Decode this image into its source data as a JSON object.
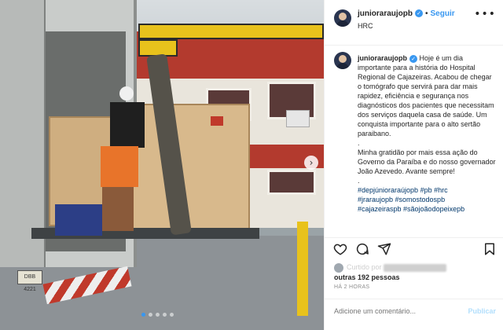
{
  "header": {
    "username": "junioraraujopb",
    "separator": "•",
    "follow_label": "Seguir",
    "location": "HRC"
  },
  "caption": {
    "username": "junioraraujopb",
    "paragraph1": "Hoje é um dia importante para a história do Hospital Regional de Cajazeiras. Acabou de chegar o tomógrafo que servirá para dar mais rapidez, eficiência e segurança nos diagnósticos dos pacientes que necessitam dos serviços daquela casa de saúde. Um conquista importante para o alto sertão paraibano.",
    "dot1": ".",
    "paragraph2": "Minha gratidão por mais essa ação do Governo da Paraíba e do nosso governador João Azevedo. Avante sempre!",
    "dot2": ".",
    "hashtags": [
      "#depjúnioraraújopb #pb #hrc",
      "#jraraujopb #somostodospb",
      "#cajazeiraspb #sãojoãodopeixepb"
    ]
  },
  "likes": {
    "others_text": "outras 192 pessoas",
    "curtido_prefix": "Curtido por"
  },
  "time": "HÁ 2 HORAS",
  "comment": {
    "placeholder": "Adicione um comentário...",
    "publish_label": "Publicar"
  },
  "photo": {
    "plate_text": "DBB 4221"
  },
  "icons": {
    "like": "heart-icon",
    "comment": "comment-icon",
    "share": "share-icon",
    "save": "bookmark-icon",
    "more": "more-options-icon",
    "verified": "verified-badge-icon",
    "next": "chevron-right-icon"
  },
  "colors": {
    "accent": "#3897f0",
    "hashtag": "#00376b",
    "muted": "#8e8e8e",
    "publish_disabled": "#b2dffc"
  }
}
